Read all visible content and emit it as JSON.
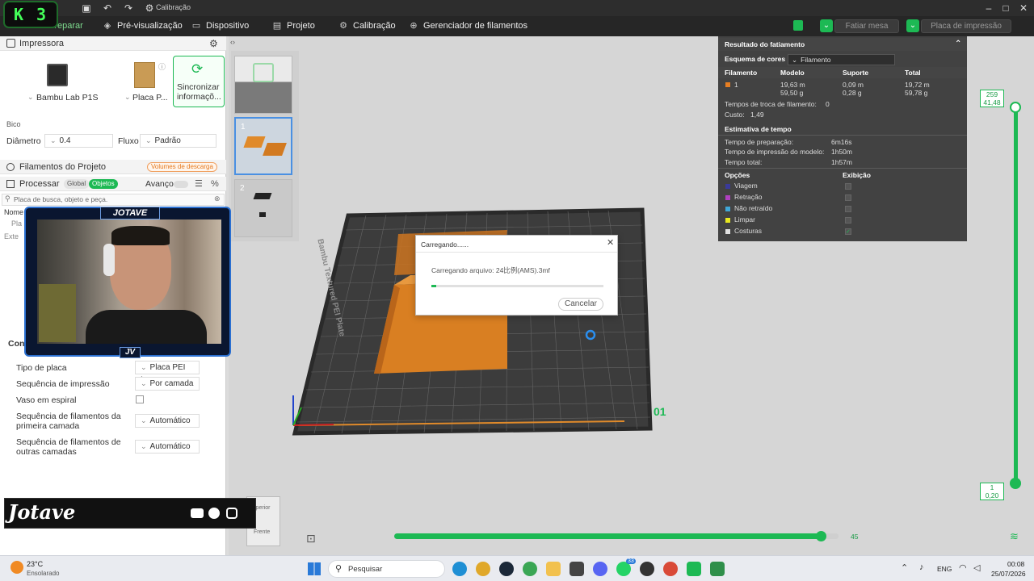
{
  "titlebar": {
    "title": "Calibração"
  },
  "streamer": {
    "badge_label": "K 3",
    "cam_name": "JOTAVE",
    "cam_tag": "JV",
    "banner_name": "Jotave"
  },
  "menu": {
    "tabs": [
      "Preparar",
      "Pré-visualização",
      "Dispositivo",
      "Projeto",
      "Calibração",
      "Gerenciador de filamentos"
    ],
    "slice_label": "Fatiar mesa",
    "print_label": "Placa de impressão"
  },
  "printer": {
    "section_title": "Impressora",
    "name": "Bambu Lab P1S",
    "plate": "Placa P...",
    "sync_label": "Sincronizar informaçõ..."
  },
  "nozzle": {
    "title": "Bico",
    "diameter_label": "Diâmetro",
    "diameter_value": "0.4",
    "flow_label": "Fluxo",
    "flow_value": "Padrão"
  },
  "filaments": {
    "section_title": "Filamentos do Projeto",
    "purge_label": "Volumes de descarga"
  },
  "process": {
    "section_title": "Processar",
    "toggle_global": "Global",
    "toggle_objects": "Objetos",
    "advanced_label": "Avanço",
    "search_placeholder": "Placa de busca, objeto e peça.",
    "list_header": "Nome",
    "list_items": [
      "Pla",
      "Exte"
    ],
    "tab_label": "Con"
  },
  "settings": [
    {
      "label": "Tipo de placa",
      "value": "Placa PEI te..."
    },
    {
      "label": "Sequência de impressão",
      "value": "Por camada"
    },
    {
      "label": "Vaso em espiral",
      "value": ""
    },
    {
      "label": "Sequência de filamentos da primeira camada",
      "value": "Automático"
    },
    {
      "label": "Sequência de filamentos de outras camadas",
      "value": "Automático"
    }
  ],
  "plates": {
    "thumb1_number": "1",
    "thumb2_number": "2"
  },
  "bed": {
    "label": "Bambu Textured PEI Plate",
    "plate_number": "01"
  },
  "dialog": {
    "title": "Carregando......",
    "message": "Carregando arquivo: 24比例(AMS).3mf",
    "progress": 0.03,
    "cancel_label": "Cancelar"
  },
  "results": {
    "title": "Resultado do fatiamento",
    "color_scheme_label": "Esquema de cores",
    "color_scheme_value": "Filamento",
    "col_filament": "Filamento",
    "col_model": "Modelo",
    "col_support": "Suporte",
    "col_total": "Total",
    "row_id": "1",
    "row_color": "#e67e22",
    "model_len": "19,63 m",
    "model_weight": "59,50 g",
    "support_len": "0,09 m",
    "support_weight": "0,28 g",
    "total_len": "19,72 m",
    "total_weight": "59,78 g",
    "change_times_label": "Tempos de troca de filamento:",
    "change_times_value": "0",
    "cost_label": "Custo:",
    "cost_value": "1,49",
    "time_title": "Estimativa de tempo",
    "prep_label": "Tempo de preparação:",
    "prep_value": "6m16s",
    "print_label": "Tempo de impressão do modelo:",
    "print_value": "1h50m",
    "total_label": "Tempo total:",
    "total_value": "1h57m",
    "options_label": "Opções",
    "display_label": "Exibição",
    "options": [
      {
        "label": "Viagem",
        "color": "#3a3a9a",
        "checked": false
      },
      {
        "label": "Retração",
        "color": "#b040c0",
        "checked": false
      },
      {
        "label": "Não retraído",
        "color": "#40a8d8",
        "checked": false
      },
      {
        "label": "Limpar",
        "color": "#e8e820",
        "checked": false
      },
      {
        "label": "Costuras",
        "color": "#e0e0e0",
        "checked": true
      }
    ]
  },
  "layer_slider": {
    "top_layer": "259",
    "top_height": "41,48",
    "bottom_layer": "1",
    "bottom_height": "0,20"
  },
  "h_slider": {
    "value": "45",
    "fraction": 0.96
  },
  "view_cube": {
    "top_label": "Superior",
    "front_label": "Frente"
  },
  "taskbar": {
    "temperature": "23°C",
    "weather": "Ensolarado",
    "search_placeholder": "Pesquisar",
    "language": "ENG",
    "time": "00:08",
    "date": "25/07/2026",
    "badge_count": "33"
  }
}
